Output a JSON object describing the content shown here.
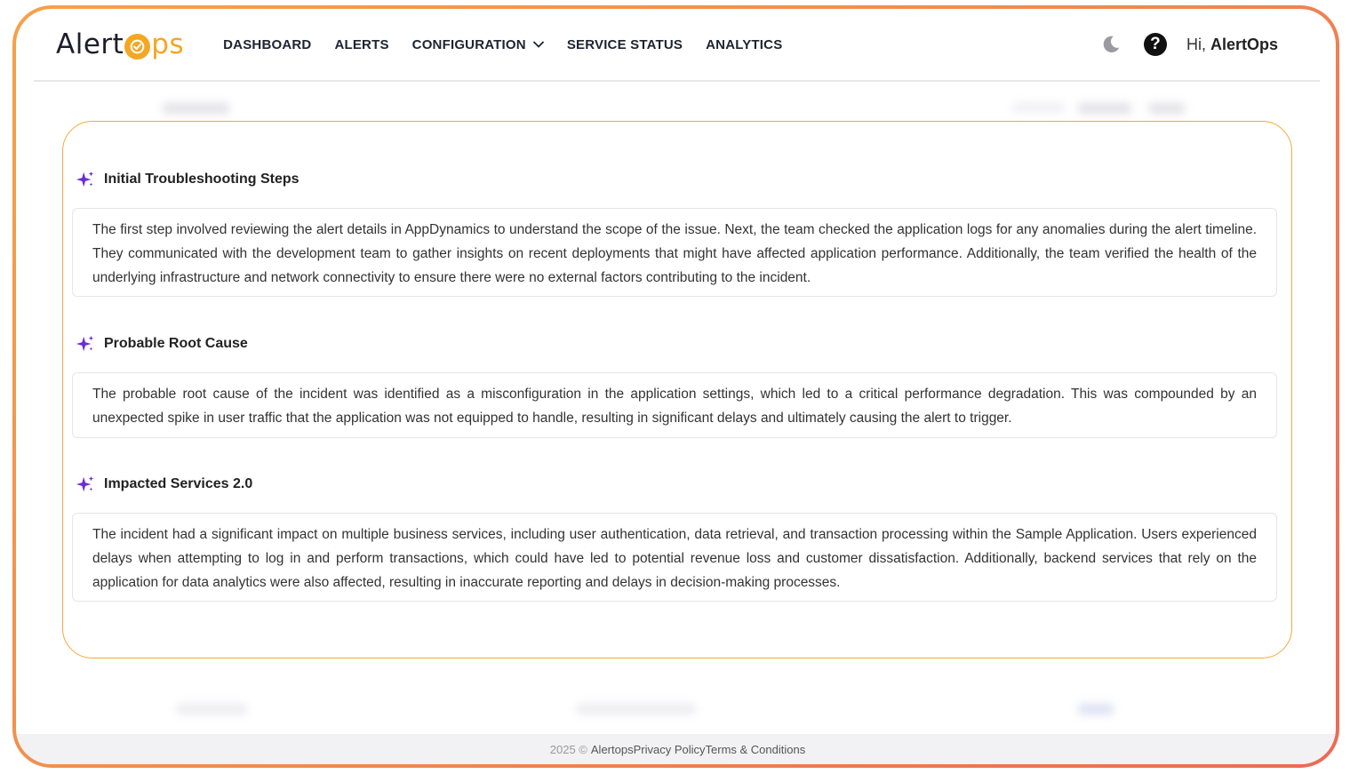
{
  "header": {
    "logo": {
      "left": "Alert",
      "right": "ps"
    },
    "nav": [
      {
        "label": "DASHBOARD"
      },
      {
        "label": "ALERTS"
      },
      {
        "label": "CONFIGURATION"
      },
      {
        "label": "SERVICE STATUS"
      },
      {
        "label": "ANALYTICS"
      }
    ],
    "greeting_prefix": "Hi,",
    "greeting_name": "AlertOps"
  },
  "sections": [
    {
      "title": "Initial Troubleshooting Steps",
      "body": "The first step involved reviewing the alert details in AppDynamics to understand the scope of the issue. Next, the team checked the application logs for any anomalies during the alert timeline. They communicated with the development team to gather insights on recent deployments that might have affected application performance. Additionally, the team verified the health of the underlying infrastructure and network connectivity to ensure there were no external factors contributing to the incident."
    },
    {
      "title": "Probable Root Cause",
      "body": "The probable root cause of the incident was identified as a misconfiguration in the application settings, which led to a critical performance degradation. This was compounded by an unexpected spike in user traffic that the application was not equipped to handle, resulting in significant delays and ultimately causing the alert to trigger."
    },
    {
      "title": "Impacted Services 2.0",
      "body": "The incident had a significant impact on multiple business services, including user authentication, data retrieval, and transaction processing within the Sample Application. Users experienced delays when attempting to log in and perform transactions, which could have led to potential revenue loss and customer dissatisfaction. Additionally, backend services that rely on the application for data analytics were also affected, resulting in inaccurate reporting and delays in decision-making processes."
    }
  ],
  "footer": {
    "copyright": "2025 ©",
    "brand": "Alertops",
    "privacy": "Privacy Policy",
    "terms": "Terms & Conditions"
  },
  "colors": {
    "accent": "#f5a623",
    "sparkle": "#6c2bd9",
    "frame_start": "#f7a04b",
    "frame_end": "#ec6a56"
  },
  "icons": [
    "clock-logo-icon",
    "chevron-down-icon",
    "moon-icon",
    "help-icon",
    "sparkle-icon"
  ]
}
